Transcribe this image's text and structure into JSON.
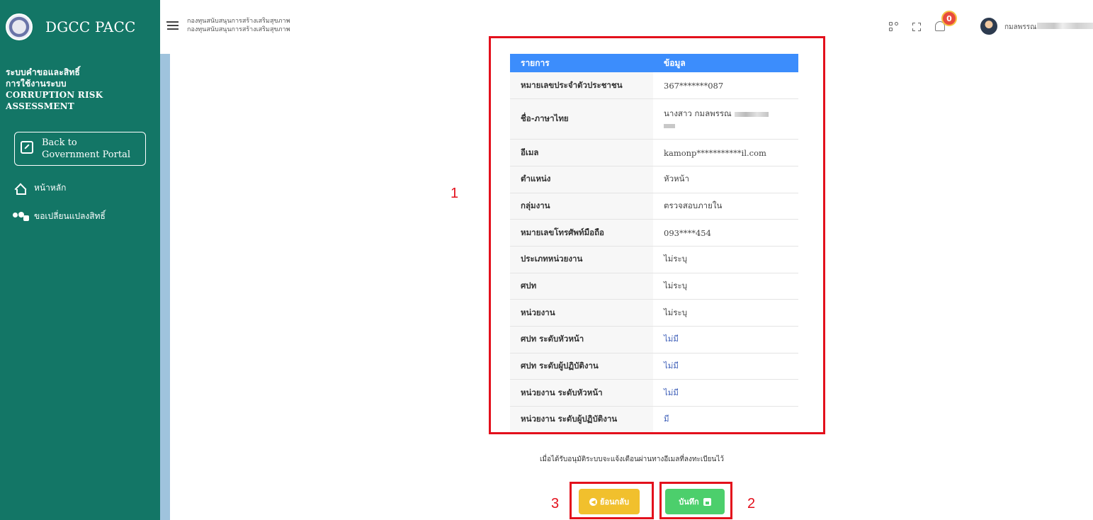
{
  "app": {
    "title": "DGCC PACC",
    "system_name_lines": [
      "ระบบคำขอและสิทธิ์",
      "การใช้งานระบบ",
      "CORRUPTION RISK",
      "ASSESSMENT"
    ]
  },
  "sidebar": {
    "back_button": {
      "line1": "Back to",
      "line2": "Government Portal"
    },
    "items": [
      {
        "label": "หน้าหลัก",
        "icon": "home-icon"
      },
      {
        "label": "ขอเปลี่ยนแปลงสิทธิ์",
        "icon": "users-gear-icon"
      }
    ]
  },
  "topbar": {
    "org_line1": "กองทุนสนับสนุนการสร้างเสริมสุขภาพ",
    "org_line2": "กองทุนสนับสนุนการสร้างเสริมสุขภาพ",
    "notification_count": "0",
    "user_name": "กมลพรรณ"
  },
  "table": {
    "headers": [
      "รายการ",
      "ข้อมูล"
    ],
    "rows": [
      {
        "label": "หมายเลขประจำตัวประชาชน",
        "value": "367*******087"
      },
      {
        "label": "ชื่อ-ภาษาไทย",
        "value": "นางสาว กมลพรรณ"
      },
      {
        "label": "อีเมล",
        "value": "kamonp***********il.com"
      },
      {
        "label": "ตำแหน่ง",
        "value": "หัวหน้า"
      },
      {
        "label": "กลุ่มงาน",
        "value": "ตรวจสอบภายใน"
      },
      {
        "label": "หมายเลขโทรศัพท์มือถือ",
        "value": "093****454"
      },
      {
        "label": "ประเภทหน่วยงาน",
        "value": "ไม่ระบุ"
      },
      {
        "label": "ศปท",
        "value": "ไม่ระบุ"
      },
      {
        "label": "หน่วยงาน",
        "value": "ไม่ระบุ"
      },
      {
        "label": "ศปท ระดับหัวหน้า",
        "value": "ไม่มี"
      },
      {
        "label": "ศปท ระดับผู้ปฏิบัติงาน",
        "value": "ไม่มี"
      },
      {
        "label": "หน่วยงาน ระดับหัวหน้า",
        "value": "ไม่มี"
      },
      {
        "label": "หน่วยงาน ระดับผู้ปฏิบัติงาน",
        "value": "มี"
      }
    ]
  },
  "notice": "เมื่อได้รับอนุมัติระบบจะแจ้งเตือนผ่านทางอีเมลที่ลงทะเบียนไว้",
  "buttons": {
    "back_label": "ย้อนกลับ",
    "save_label": "บันทึก"
  },
  "annotations": [
    "1",
    "2",
    "3"
  ],
  "colors": {
    "sidebar": "#137666",
    "table_header": "#3c8dfc",
    "back_button": "#f1c02d",
    "save_button": "#4ccf6c",
    "annotation": "#e3101c"
  }
}
